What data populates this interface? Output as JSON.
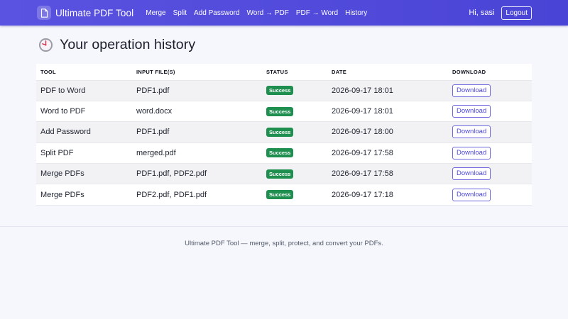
{
  "navbar": {
    "brand": "Ultimate PDF Tool",
    "links": [
      "Merge",
      "Split",
      "Add Password",
      "Word → PDF",
      "PDF → Word",
      "History"
    ],
    "greeting": "Hi, sasi",
    "logout_label": "Logout"
  },
  "page": {
    "title": "Your operation history"
  },
  "table": {
    "headers": {
      "tool": "TOOL",
      "input": "INPUT FILE(S)",
      "status": "STATUS",
      "date": "DATE",
      "download": "DOWNLOAD"
    },
    "rows": [
      {
        "tool": "PDF to Word",
        "input": "PDF1.pdf",
        "status": "Success",
        "date": "2026-09-17 18:01",
        "download": "Download"
      },
      {
        "tool": "Word to PDF",
        "input": "word.docx",
        "status": "Success",
        "date": "2026-09-17 18:01",
        "download": "Download"
      },
      {
        "tool": "Add Password",
        "input": "PDF1.pdf",
        "status": "Success",
        "date": "2026-09-17 18:00",
        "download": "Download"
      },
      {
        "tool": "Split PDF",
        "input": "merged.pdf",
        "status": "Success",
        "date": "2026-09-17 17:58",
        "download": "Download"
      },
      {
        "tool": "Merge PDFs",
        "input": "PDF1.pdf, PDF2.pdf",
        "status": "Success",
        "date": "2026-09-17 17:58",
        "download": "Download"
      },
      {
        "tool": "Merge PDFs",
        "input": "PDF2.pdf, PDF1.pdf",
        "status": "Success",
        "date": "2026-09-17 17:18",
        "download": "Download"
      }
    ]
  },
  "footer": {
    "text": "Ultimate PDF Tool — merge, split, protect, and convert your PDFs."
  },
  "colors": {
    "navbar": "#5a52e0",
    "success": "#1e8f4f",
    "accent": "#4b45d4",
    "background": "#f5f7fc"
  },
  "icons": {
    "brand": "document-icon",
    "history": "clock-icon"
  }
}
